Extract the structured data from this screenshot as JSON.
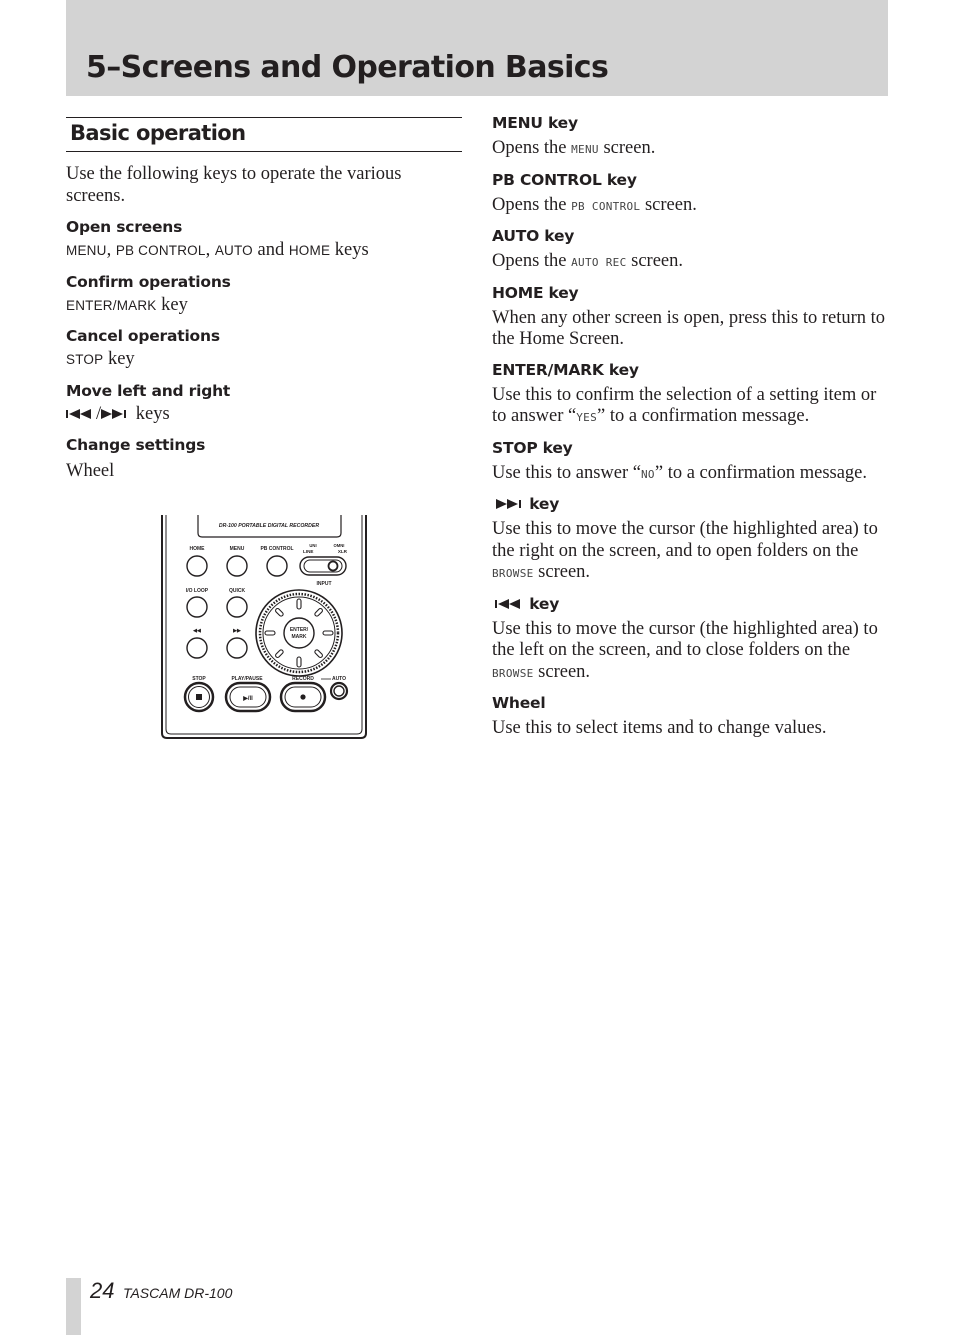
{
  "header": {
    "chapter_title": "5–Screens and Operation Basics"
  },
  "left": {
    "section_title": "Basic operation",
    "intro": "Use the following keys to operate the various screens.",
    "items": [
      {
        "heading": "Open screens",
        "parts": {
          "k1": "MENU",
          "s1": ", ",
          "k2": "PB CONTROL",
          "s2": ", ",
          "k3": "AUTO",
          "s3": " and ",
          "k4": "HOME",
          "s4": " keys"
        }
      },
      {
        "heading": "Confirm operations",
        "parts": {
          "k1": "ENTER/MARK",
          "s1": " key"
        }
      },
      {
        "heading": "Cancel operations",
        "parts": {
          "k1": "STOP",
          "s1": " key"
        }
      },
      {
        "heading": "Move left and right",
        "parts": {
          "icon_left": "skip-back-icon",
          "sep": "/",
          "icon_right": "skip-forward-icon",
          "s1": " keys"
        }
      },
      {
        "heading": "Change settings",
        "parts": {
          "s1": "Wheel"
        }
      }
    ]
  },
  "device": {
    "label": "DR-100 PORTABLE DIGITAL RECORDER",
    "buttons": {
      "home": "HOME",
      "menu": "MENU",
      "pb_control": "PB CONTROL",
      "io_loop": "I/O LOOP",
      "quick": "QUICK",
      "skip_back": "◀◀",
      "skip_fwd": "▶▶",
      "stop": "STOP",
      "play_pause": "PLAY/PAUSE",
      "record": "RECORD",
      "auto": "AUTO",
      "enter_line1": "ENTER/",
      "enter_line2": "MARK",
      "play_glyph": "▶/II"
    },
    "input_switch": {
      "label": "INPUT",
      "top_left": "UNI",
      "top_right": "OMNI",
      "left": "LINE",
      "right": "XLR"
    }
  },
  "right": {
    "items": [
      {
        "heading": "MENU key",
        "text": {
          "a": "Opens the ",
          "lcd": "MENU",
          "b": " screen."
        }
      },
      {
        "heading": "PB CONTROL key",
        "text": {
          "a": "Opens the ",
          "lcd": "PB CONTROL",
          "b": " screen."
        }
      },
      {
        "heading": "AUTO key",
        "text": {
          "a": "Opens the ",
          "lcd": "AUTO REC",
          "b": " screen."
        }
      },
      {
        "heading": "HOME key",
        "text": {
          "a": "When any other screen is open, press this to return to the Home Screen."
        }
      },
      {
        "heading": "ENTER/MARK key",
        "text": {
          "a": "Use this to confirm the selection of a setting item or to answer “",
          "lcd": "YES",
          "b": "” to a confirmation message."
        }
      },
      {
        "heading": "STOP key",
        "text": {
          "a": "Use this to answer “",
          "lcd": "NO",
          "b": "” to a confirmation message."
        }
      },
      {
        "heading": "key",
        "icon": "skip-forward-icon",
        "text": {
          "a": "Use this to move the cursor (the highlighted area) to the right on the screen, and to open folders on the ",
          "lcd": "BROWSE",
          "b": " screen."
        }
      },
      {
        "heading": "key",
        "icon": "skip-back-icon",
        "text": {
          "a": "Use this to move the cursor (the highlighted area) to the left on the screen, and to close folders on the ",
          "lcd": "BROWSE",
          "b": " screen."
        }
      },
      {
        "heading": "Wheel",
        "text": {
          "a": "Use this to select items and to change values."
        }
      }
    ]
  },
  "footer": {
    "page_number": "24",
    "brand": "TASCAM  DR-100"
  }
}
